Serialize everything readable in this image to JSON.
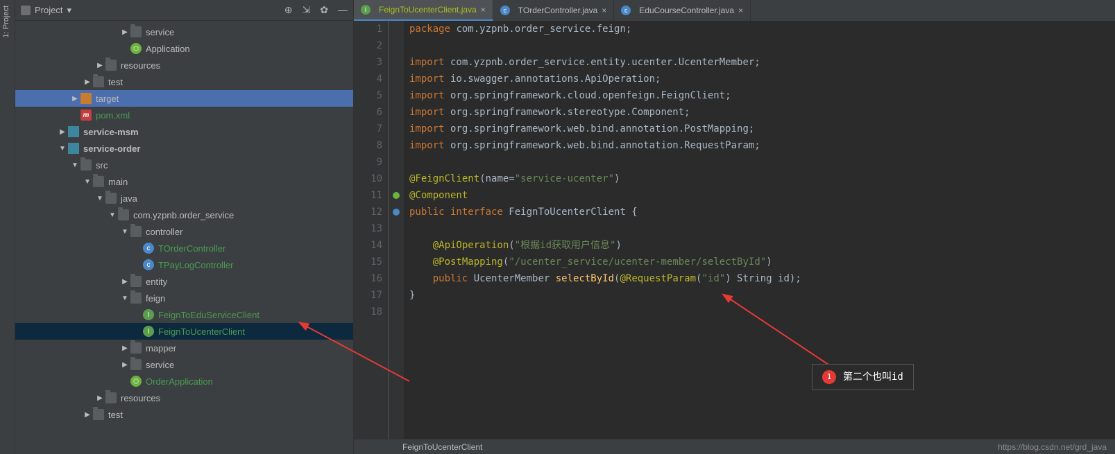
{
  "sidebar_tab": "1: Project",
  "panel": {
    "title": "Project",
    "dropdown": "▾"
  },
  "toolbar": {
    "target": "⊕",
    "collapse": "⇲",
    "gear": "✿",
    "hide": "—"
  },
  "tree": [
    {
      "depth": 5,
      "arrow": "right",
      "icon": "folder",
      "label": "service"
    },
    {
      "depth": 5,
      "arrow": "none",
      "icon": "spring",
      "iconText": "⬡",
      "label": "Application"
    },
    {
      "depth": 3,
      "arrow": "right",
      "icon": "folder",
      "label": "resources"
    },
    {
      "depth": 2,
      "arrow": "right",
      "icon": "folder",
      "label": "test"
    },
    {
      "depth": 1,
      "arrow": "right",
      "icon": "folder-orange",
      "label": "target",
      "highlighted": true
    },
    {
      "depth": 1,
      "arrow": "none",
      "icon": "m",
      "iconText": "m",
      "label": "pom.xml",
      "labelClass": "green"
    },
    {
      "depth": 0,
      "arrow": "right",
      "icon": "folder-blue",
      "label": "service-msm",
      "labelClass": "bold"
    },
    {
      "depth": 0,
      "arrow": "down",
      "icon": "folder-blue",
      "label": "service-order",
      "labelClass": "bold"
    },
    {
      "depth": 1,
      "arrow": "down",
      "icon": "folder",
      "label": "src"
    },
    {
      "depth": 2,
      "arrow": "down",
      "icon": "folder",
      "label": "main"
    },
    {
      "depth": 3,
      "arrow": "down",
      "icon": "folder",
      "label": "java"
    },
    {
      "depth": 4,
      "arrow": "down",
      "icon": "folder",
      "label": "com.yzpnb.order_service"
    },
    {
      "depth": 5,
      "arrow": "down",
      "icon": "folder",
      "label": "controller"
    },
    {
      "depth": 6,
      "arrow": "none",
      "icon": "c",
      "iconText": "c",
      "label": "TOrderController",
      "labelClass": "green"
    },
    {
      "depth": 6,
      "arrow": "none",
      "icon": "c",
      "iconText": "c",
      "label": "TPayLogController",
      "labelClass": "green"
    },
    {
      "depth": 5,
      "arrow": "right",
      "icon": "folder",
      "label": "entity"
    },
    {
      "depth": 5,
      "arrow": "down",
      "icon": "folder",
      "label": "feign"
    },
    {
      "depth": 6,
      "arrow": "none",
      "icon": "i",
      "iconText": "I",
      "label": "FeignToEduServiceClient",
      "labelClass": "green"
    },
    {
      "depth": 6,
      "arrow": "none",
      "icon": "i",
      "iconText": "I",
      "label": "FeignToUcenterClient",
      "labelClass": "green",
      "selected": true
    },
    {
      "depth": 5,
      "arrow": "right",
      "icon": "folder",
      "label": "mapper"
    },
    {
      "depth": 5,
      "arrow": "right",
      "icon": "folder",
      "label": "service"
    },
    {
      "depth": 5,
      "arrow": "none",
      "icon": "spring",
      "iconText": "⬡",
      "label": "OrderApplication",
      "labelClass": "green"
    },
    {
      "depth": 3,
      "arrow": "right",
      "icon": "folder",
      "label": "resources"
    },
    {
      "depth": 2,
      "arrow": "right",
      "icon": "folder",
      "label": "test"
    }
  ],
  "tabs": [
    {
      "icon": "i",
      "iconText": "I",
      "label": "FeignToUcenterClient.java",
      "active": true
    },
    {
      "icon": "c",
      "iconText": "c",
      "label": "TOrderController.java"
    },
    {
      "icon": "c",
      "iconText": "c",
      "label": "EduCourseController.java"
    }
  ],
  "code": {
    "lines": [
      {
        "n": 1,
        "html": "<span class='kw'>package</span> com.yzpnb.order_service.feign;"
      },
      {
        "n": 2,
        "html": ""
      },
      {
        "n": 3,
        "html": "<span class='kw'>import</span> com.yzpnb.order_service.entity.ucenter.UcenterMember;"
      },
      {
        "n": 4,
        "html": "<span class='kw'>import</span> io.swagger.annotations.ApiOperation;"
      },
      {
        "n": 5,
        "html": "<span class='kw'>import</span> org.springframework.cloud.openfeign.FeignClient;"
      },
      {
        "n": 6,
        "html": "<span class='kw'>import</span> org.springframework.stereotype.Component;"
      },
      {
        "n": 7,
        "html": "<span class='kw'>import</span> org.springframework.web.bind.annotation.PostMapping;"
      },
      {
        "n": 8,
        "html": "<span class='kw'>import</span> org.springframework.web.bind.annotation.RequestParam;"
      },
      {
        "n": 9,
        "html": ""
      },
      {
        "n": 10,
        "html": "<span class='ann'>@FeignClient</span>(name=<span class='str'>\"service-ucenter\"</span>)"
      },
      {
        "n": 11,
        "html": "<span class='ann'>@Component</span>",
        "gutter": "spring"
      },
      {
        "n": 12,
        "html": "<span class='kw'>public interface</span> <span class='cls'>FeignToUcenterClient</span> {",
        "gutter": "impl"
      },
      {
        "n": 13,
        "html": ""
      },
      {
        "n": 14,
        "html": "    <span class='ann'>@ApiOperation</span>(<span class='str'>\"根据id获取用户信息\"</span>)"
      },
      {
        "n": 15,
        "html": "    <span class='ann'>@PostMapping</span>(<span class='str'>\"/ucenter_service/ucenter-member/selectById\"</span>)"
      },
      {
        "n": 16,
        "html": "    <span class='kw'>public</span> UcenterMember <span class='typ'>selectById</span>(<span class='ann'>@RequestParam</span>(<span class='str'>\"id\"</span>) String id);"
      },
      {
        "n": 17,
        "html": "}"
      },
      {
        "n": 18,
        "html": ""
      }
    ]
  },
  "breadcrumb": "FeignToUcenterClient",
  "watermark": "https://blog.csdn.net/grd_java",
  "callout": {
    "num": "1",
    "text": "第二个也叫id"
  }
}
